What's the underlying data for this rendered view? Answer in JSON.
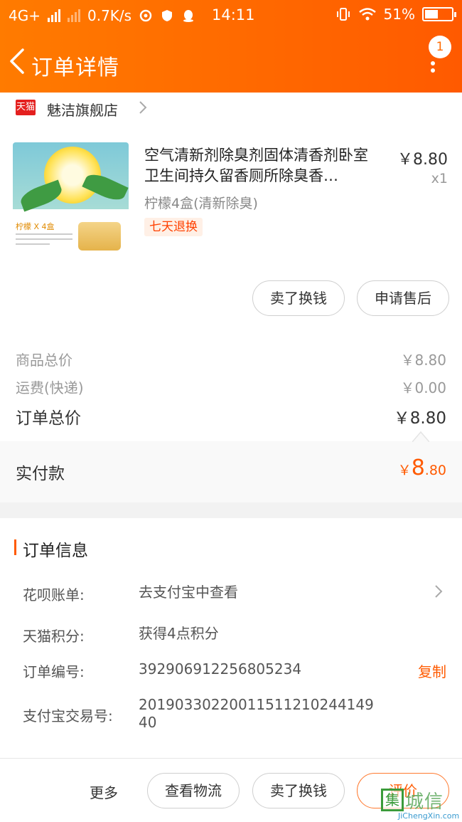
{
  "status_bar": {
    "network": "4G+",
    "speed": "0.7K/s",
    "time": "14:11",
    "battery": "51%",
    "battery_level": 0.51
  },
  "header": {
    "title": "订单详情",
    "badge_count": "1",
    "accent": "#ff6a00"
  },
  "shop": {
    "logo_text": "天猫",
    "name": "魅洁旗舰店"
  },
  "product": {
    "title": "空气清新剂除臭剂固体清香剂卧室卫生间持久留香厕所除臭香…",
    "price": "￥8.80",
    "qty": "x1",
    "sku": "柠檬4盒(清新除臭)",
    "tag": "七天退换",
    "image_label": "柠檬 X 4盒",
    "buttons": {
      "sell": "卖了换钱",
      "after_sale": "申请售后"
    }
  },
  "summary": {
    "goods_total_label": "商品总价",
    "goods_total": "￥8.80",
    "shipping_label": "运费(快递)",
    "shipping": "￥0.00",
    "order_total_label": "订单总价",
    "order_total": "￥8.80",
    "paid_label": "实付款",
    "paid_currency": "￥",
    "paid_int": "8",
    "paid_dec": ".80"
  },
  "order_info": {
    "title": "订单信息",
    "rows": [
      {
        "key": "花呗账单:",
        "value": "去支付宝中查看"
      },
      {
        "key": "天猫积分:",
        "value": "获得4点积分"
      },
      {
        "key": "订单编号:",
        "value": "392906912256805234"
      },
      {
        "key": "支付宝交易号:",
        "value": "2019033022001151121024414940"
      }
    ],
    "copy_label": "复制"
  },
  "bottom_bar": {
    "more": "更多",
    "logistics": "查看物流",
    "sell": "卖了换钱",
    "review": "评价"
  },
  "watermark": {
    "logo_char": "集",
    "text": "城信",
    "url": "JiChengXin.com"
  }
}
